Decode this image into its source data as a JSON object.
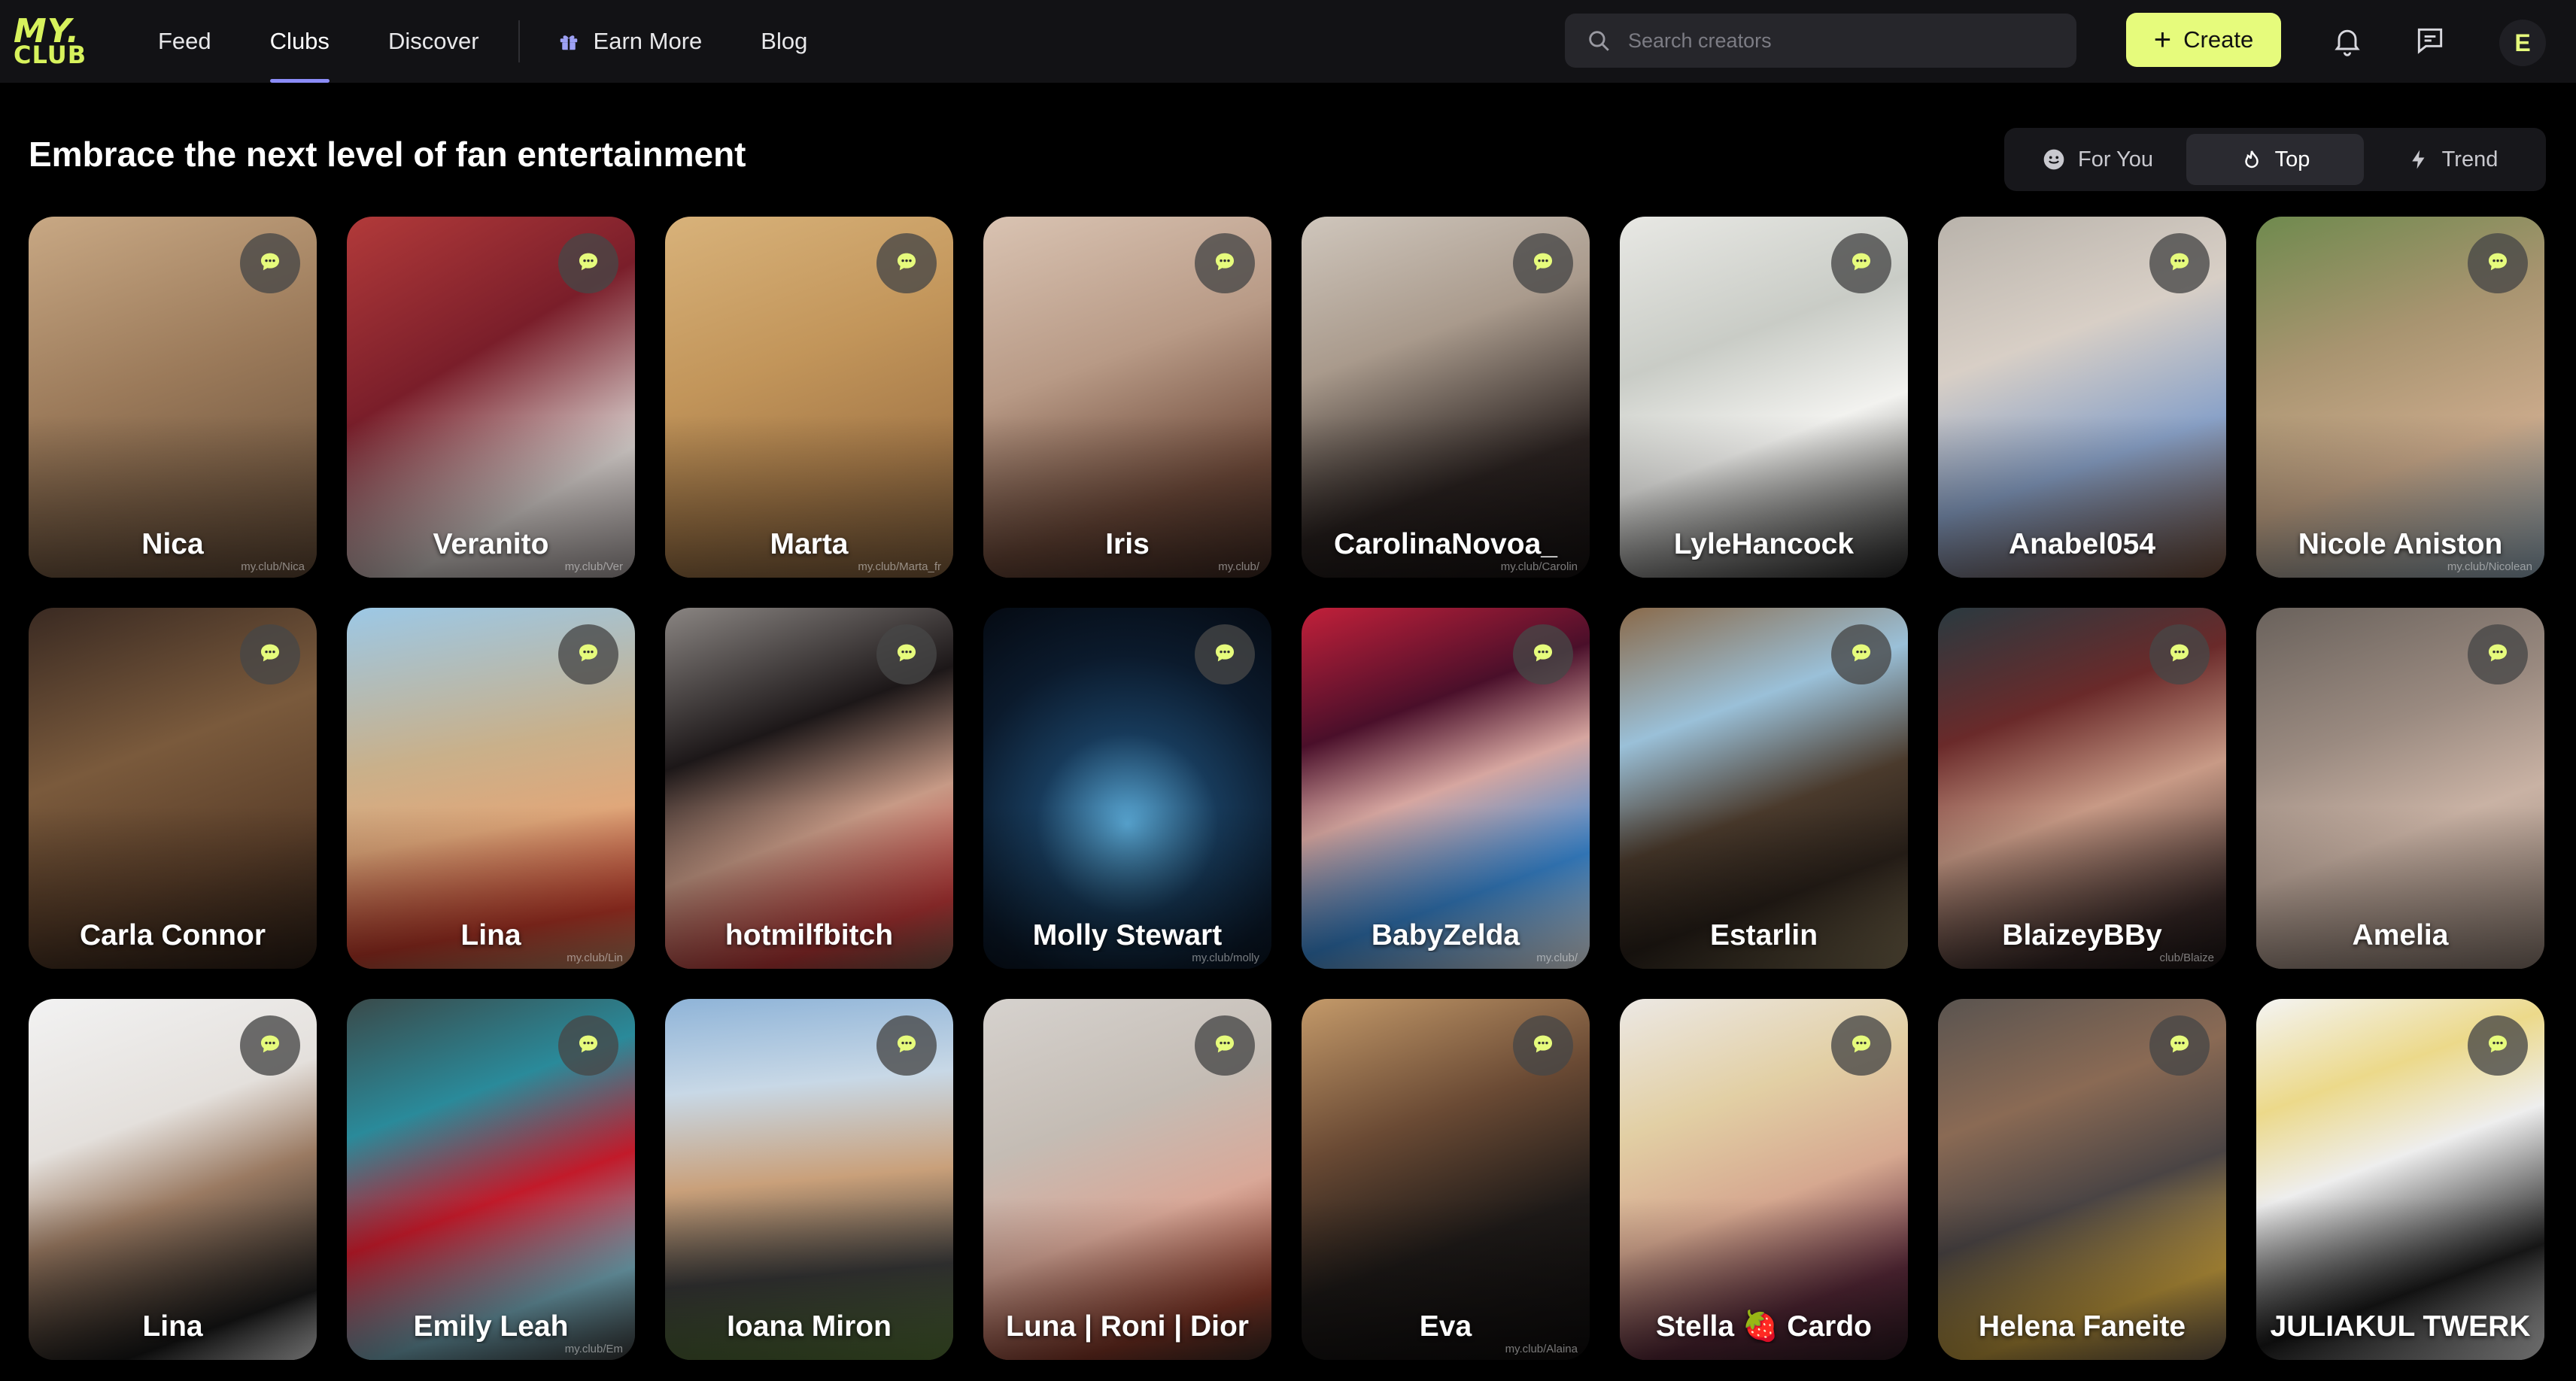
{
  "logo": {
    "line1": "MY.",
    "line2": "CLUB"
  },
  "nav": [
    {
      "label": "Feed",
      "active": false
    },
    {
      "label": "Clubs",
      "active": true
    },
    {
      "label": "Discover",
      "active": false
    },
    {
      "label": "Earn More",
      "active": false,
      "icon": "gift-icon"
    },
    {
      "label": "Blog",
      "active": false
    }
  ],
  "search": {
    "placeholder": "Search creators",
    "value": ""
  },
  "create_button": {
    "label": "Create"
  },
  "account": {
    "initial": "E"
  },
  "page_title": "Embrace the next level of fan entertainment",
  "sort_tabs": [
    {
      "label": "For You",
      "icon": "smile-icon",
      "active": false
    },
    {
      "label": "Top",
      "icon": "flame-icon",
      "active": true
    },
    {
      "label": "Trend",
      "icon": "lightning-icon",
      "active": false
    }
  ],
  "colors": {
    "accent": "#e6fb7c",
    "tab_underline": "#8b8cf7",
    "bg": "#000000",
    "topbar": "#121215"
  },
  "creators": [
    {
      "name": "Nica",
      "watermark": "my.club/Nica"
    },
    {
      "name": "Veranito",
      "watermark": "my.club/Ver"
    },
    {
      "name": "Marta",
      "watermark": "my.club/Marta_fr"
    },
    {
      "name": "Iris",
      "watermark": "my.club/"
    },
    {
      "name": "CarolinaNovoa_",
      "watermark": "my.club/Carolin"
    },
    {
      "name": "LyleHancock",
      "watermark": ""
    },
    {
      "name": "Anabel054",
      "watermark": ""
    },
    {
      "name": "Nicole Aniston",
      "watermark": "my.club/Nicolean"
    },
    {
      "name": "Carla Connor",
      "watermark": ""
    },
    {
      "name": "Lina",
      "watermark": "my.club/Lin"
    },
    {
      "name": "hotmilfbitch",
      "watermark": ""
    },
    {
      "name": "Molly Stewart",
      "watermark": "my.club/molly"
    },
    {
      "name": "BabyZelda",
      "watermark": "my.club/"
    },
    {
      "name": "Estarlin",
      "watermark": ""
    },
    {
      "name": "BlaizeyBBy",
      "watermark": "club/Blaize"
    },
    {
      "name": "Amelia",
      "watermark": ""
    },
    {
      "name": "Lina",
      "watermark": ""
    },
    {
      "name": "Emily Leah",
      "watermark": "my.club/Em"
    },
    {
      "name": "Ioana Miron",
      "watermark": ""
    },
    {
      "name": "Luna | Roni | Dior",
      "watermark": ""
    },
    {
      "name": "Eva",
      "watermark": "my.club/Alaina"
    },
    {
      "name": "Stella 🍓 Cardo",
      "watermark": ""
    },
    {
      "name": "Helena Faneite",
      "watermark": ""
    },
    {
      "name": "JULIAKUL TWERK",
      "watermark": ""
    }
  ]
}
